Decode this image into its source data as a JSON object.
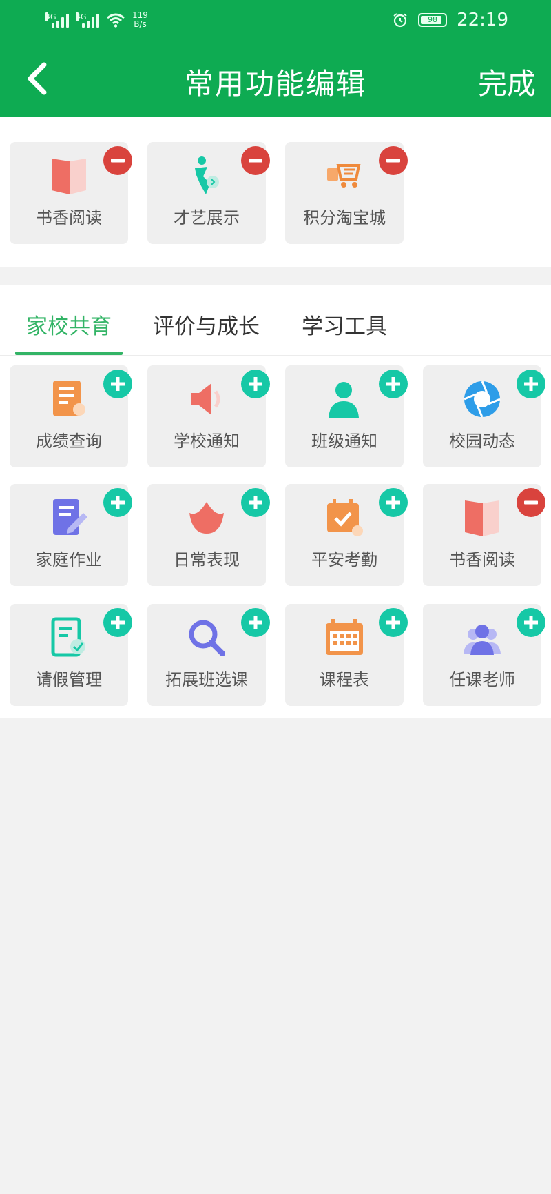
{
  "status_bar": {
    "sim1_label": "4G",
    "sim2_label": "4G",
    "net_speed_value": "119",
    "net_speed_unit": "B/s",
    "battery": "98",
    "time": "22:19"
  },
  "header": {
    "title": "常用功能编辑",
    "done_label": "完成"
  },
  "favorites": [
    {
      "label": "书香阅读",
      "icon": "book-icon"
    },
    {
      "label": "才艺展示",
      "icon": "talent-icon"
    },
    {
      "label": "积分淘宝城",
      "icon": "shopping-cart-icon"
    }
  ],
  "tabs": [
    {
      "label": "家校共育",
      "active": true
    },
    {
      "label": "评价与成长",
      "active": false
    },
    {
      "label": "学习工具",
      "active": false
    }
  ],
  "functions": [
    {
      "label": "成绩查询",
      "icon": "report-icon",
      "action": "add"
    },
    {
      "label": "学校通知",
      "icon": "speaker-icon",
      "action": "add"
    },
    {
      "label": "班级通知",
      "icon": "person-icon",
      "action": "add"
    },
    {
      "label": "校园动态",
      "icon": "aperture-icon",
      "action": "add"
    },
    {
      "label": "家庭作业",
      "icon": "homework-icon",
      "action": "add"
    },
    {
      "label": "日常表现",
      "icon": "lotus-icon",
      "action": "add"
    },
    {
      "label": "平安考勤",
      "icon": "calendar-check-icon",
      "action": "add"
    },
    {
      "label": "书香阅读",
      "icon": "book-icon",
      "action": "remove"
    },
    {
      "label": "请假管理",
      "icon": "leave-form-icon",
      "action": "add"
    },
    {
      "label": "拓展班选课",
      "icon": "search-icon",
      "action": "add"
    },
    {
      "label": "课程表",
      "icon": "timetable-icon",
      "action": "add"
    },
    {
      "label": "任课老师",
      "icon": "teachers-icon",
      "action": "add"
    }
  ],
  "colors": {
    "header_bg": "#0eab52",
    "tab_active": "#33b466",
    "add_badge": "#16c8a6",
    "remove_badge": "#d9433d"
  }
}
